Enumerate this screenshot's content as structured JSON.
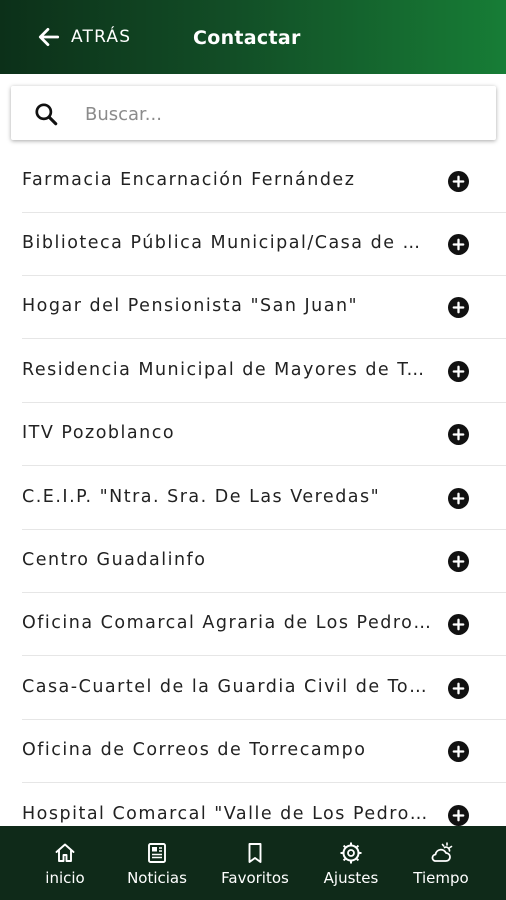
{
  "header": {
    "back_label": "ATRÁS",
    "title": "Contactar"
  },
  "search": {
    "placeholder": "Buscar..."
  },
  "contacts": [
    "Farmacia Encarnación Fernández",
    "Biblioteca Pública Municipal/Casa de Cultura",
    "Hogar del Pensionista \"San Juan\"",
    "Residencia Municipal de Mayores de Torrecampo",
    "ITV Pozoblanco",
    "C.E.I.P. \"Ntra. Sra. De Las Veredas\"",
    "Centro Guadalinfo",
    "Oficina Comarcal Agraria de Los Pedroches",
    "Casa-Cuartel de la Guardia Civil de Torrecampo",
    "Oficina de Correos de Torrecampo",
    "Hospital Comarcal \"Valle de Los Pedroches\""
  ],
  "tabbar": {
    "items": [
      {
        "label": "inicio",
        "icon": "home-icon"
      },
      {
        "label": "Noticias",
        "icon": "newspaper-icon"
      },
      {
        "label": "Favoritos",
        "icon": "bookmark-icon"
      },
      {
        "label": "Ajustes",
        "icon": "gear-icon"
      },
      {
        "label": "Tiempo",
        "icon": "weather-icon"
      }
    ]
  },
  "colors": {
    "header_start": "#0c3019",
    "header_end": "#177d36",
    "tabbar": "#0f2a19",
    "text": "#222222"
  }
}
